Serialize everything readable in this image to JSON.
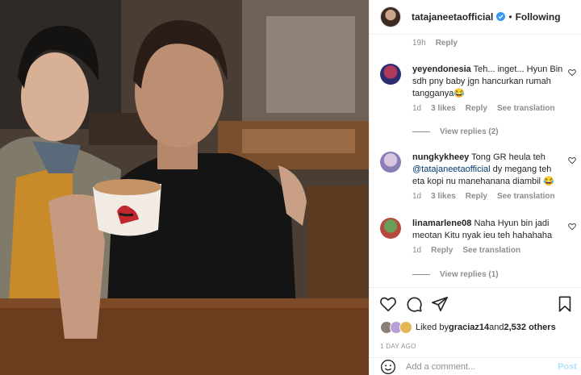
{
  "header": {
    "username": "tatajaneetaofficial",
    "separator": "•",
    "follow_status": "Following"
  },
  "comments": {
    "truncated": {
      "time": "19h",
      "reply_label": "Reply"
    },
    "items": [
      {
        "username": "yeyendonesia",
        "text": "Teh... inget... Hyun Bin sdh pny baby jgn hancurkan rumah tangganya😂",
        "time": "1d",
        "likes": "3 likes",
        "reply_label": "Reply",
        "translate_label": "See translation",
        "view_replies": "View replies (2)"
      },
      {
        "username": "nungkykheey",
        "text_before": "Tong GR heula teh ",
        "mention": "@tatajaneetaofficial",
        "text_after": " dy megang teh eta kopi nu manehanana diambil 😂",
        "time": "1d",
        "likes": "3 likes",
        "reply_label": "Reply",
        "translate_label": "See translation"
      },
      {
        "username": "linamarlene08",
        "text": "Naha Hyun bin jadi meotan Kitu nyak ieu teh hahahaha",
        "time": "1d",
        "reply_label": "Reply",
        "translate_label": "See translation",
        "view_replies": "View replies (1)"
      }
    ]
  },
  "likes": {
    "prefix": "Liked by ",
    "user": "graciaz14",
    "joiner": " and ",
    "others": "2,532 others"
  },
  "timestamp": "1 DAY AGO",
  "add_comment": {
    "placeholder": "Add a comment...",
    "post_label": "Post"
  },
  "colors": {
    "verified": "#3897f0",
    "link": "#00376b",
    "muted": "#8e8e8e",
    "post_disabled": "#b2dffc"
  }
}
